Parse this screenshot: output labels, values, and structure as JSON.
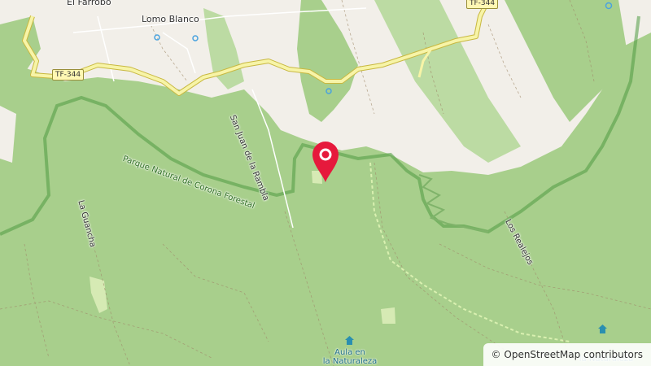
{
  "map": {
    "places": [
      "El Farrobo",
      "Lomo Blanco"
    ],
    "road_ref": "TF-344",
    "streets": [
      "San Juan de la Rambla",
      "La Guancha",
      "Los Realejos"
    ],
    "protected_area": "Parque Natural de Corona Forestal",
    "poi": {
      "label_line1": "Aula en",
      "label_line2": "la Naturaleza"
    },
    "marker_icon": "map-pin-marker",
    "colors": {
      "forest": "#a8cf8c",
      "urban": "#f2efe9",
      "road_secondary": "#f7f4a7",
      "boundary": "#4f9a42",
      "marker": "#e6193c"
    }
  },
  "attribution": {
    "symbol": "©",
    "text": "OpenStreetMap contributors"
  }
}
